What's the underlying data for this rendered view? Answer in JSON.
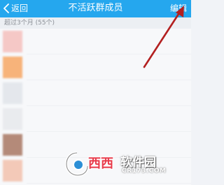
{
  "header": {
    "back_label": "返回",
    "title": "不活跃群成员",
    "edit_label": "编辑"
  },
  "section": {
    "label": "超过3个月 (55个)"
  },
  "members": [
    {
      "avatar_color": "#f5c8c6"
    },
    {
      "avatar_color": "#f7b37a"
    },
    {
      "avatar_color": "#e4e7ec"
    },
    {
      "avatar_color": "#e9ebee"
    },
    {
      "avatar_color": "#b48a79"
    },
    {
      "avatar_color": "#f3c9b8"
    }
  ],
  "watermark": {
    "brand": "西西",
    "name": "软件园",
    "domain": "CR173.COM"
  },
  "colors": {
    "header_bg": "#25a7ee",
    "arrow": "#b32020"
  }
}
